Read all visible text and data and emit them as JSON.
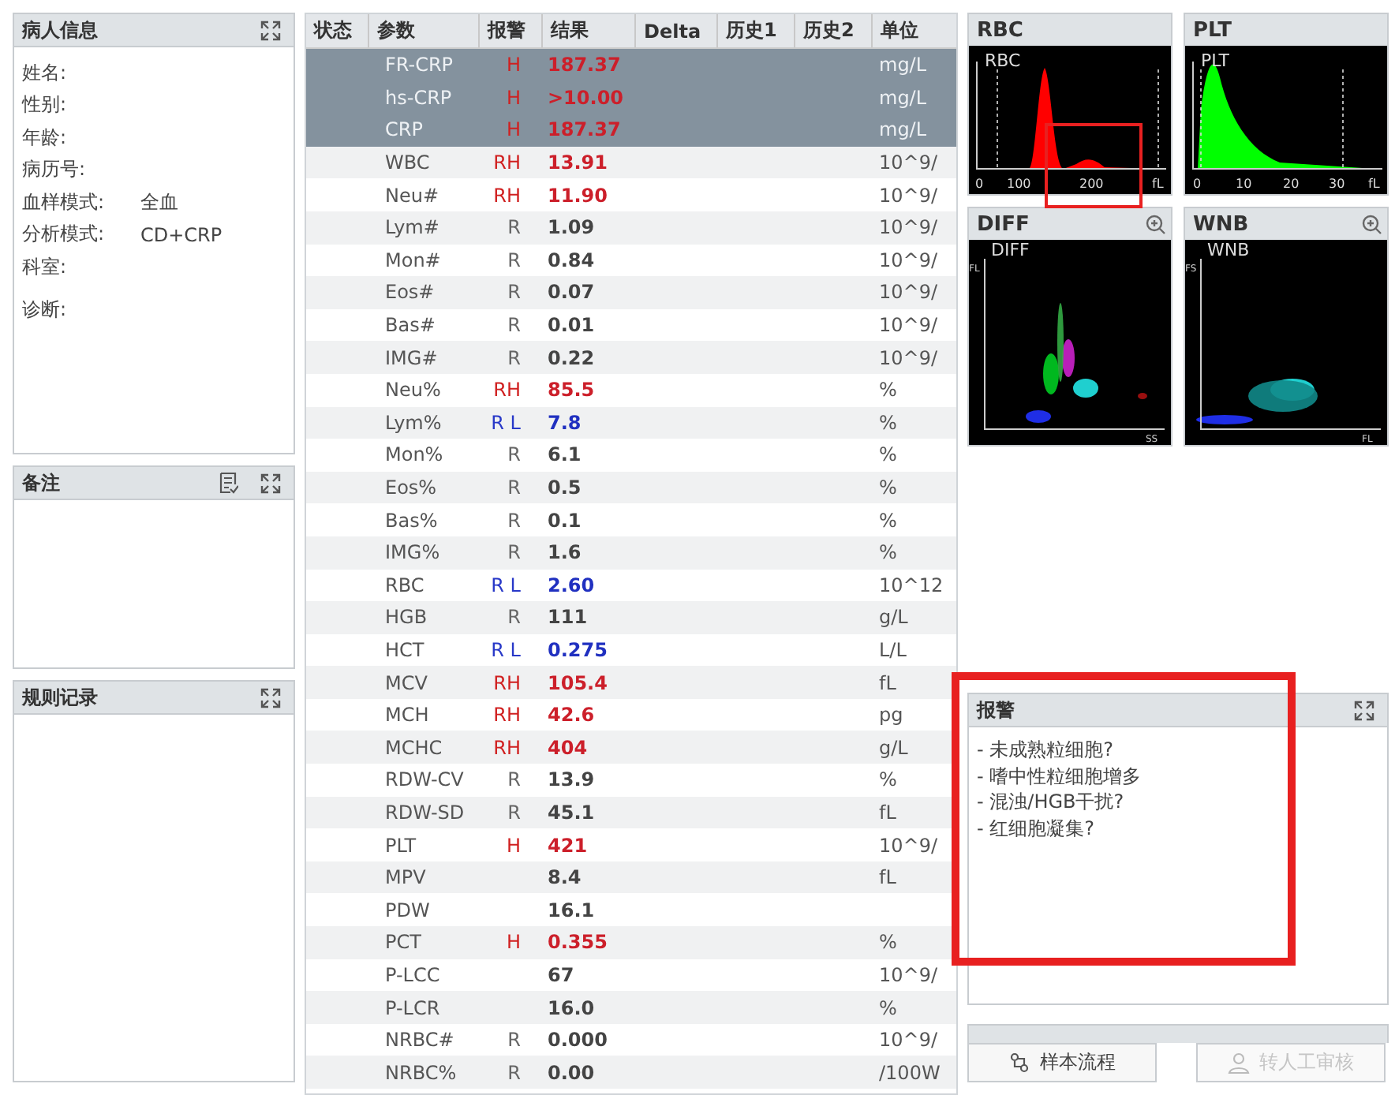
{
  "patient_panel": {
    "title": "病人信息",
    "fields": [
      {
        "label": "姓名:"
      },
      {
        "label": "性别:"
      },
      {
        "label": "年龄:"
      },
      {
        "label": "病历号:"
      },
      {
        "label": "血样模式:",
        "value": "全血"
      },
      {
        "label": "分析模式:",
        "value": "CD+CRP"
      },
      {
        "label": "科室:"
      },
      {
        "label": "诊断:"
      }
    ]
  },
  "notes_panel": {
    "title": "备注"
  },
  "rules_panel": {
    "title": "规则记录"
  },
  "table": {
    "columns": [
      "状态",
      "参数",
      "报警",
      "结果",
      "Delta",
      "历史1",
      "历史2",
      "单位"
    ],
    "rows": [
      {
        "param": "FR-CRP",
        "flag": "H",
        "result": "187.37",
        "unit": "mg/L",
        "kind": "high",
        "selected": true
      },
      {
        "param": "hs-CRP",
        "flag": "H",
        "result": ">10.00",
        "unit": "mg/L",
        "kind": "high",
        "selected": true
      },
      {
        "param": "CRP",
        "flag": "H",
        "result": "187.37",
        "unit": "mg/L",
        "kind": "high",
        "selected": true
      },
      {
        "param": "WBC",
        "flag": "RH",
        "result": "13.91",
        "unit": "10^9/",
        "kind": "high",
        "selected": false
      },
      {
        "param": "Neu#",
        "flag": "RH",
        "result": "11.90",
        "unit": "10^9/",
        "kind": "high",
        "selected": false
      },
      {
        "param": "Lym#",
        "flag": "R",
        "result": "1.09",
        "unit": "10^9/",
        "kind": "normal",
        "selected": false
      },
      {
        "param": "Mon#",
        "flag": "R",
        "result": "0.84",
        "unit": "10^9/",
        "kind": "normal",
        "selected": false
      },
      {
        "param": "Eos#",
        "flag": "R",
        "result": "0.07",
        "unit": "10^9/",
        "kind": "normal",
        "selected": false
      },
      {
        "param": "Bas#",
        "flag": "R",
        "result": "0.01",
        "unit": "10^9/",
        "kind": "normal",
        "selected": false
      },
      {
        "param": "IMG#",
        "flag": "R",
        "result": "0.22",
        "unit": "10^9/",
        "kind": "normal",
        "selected": false
      },
      {
        "param": "Neu%",
        "flag": "RH",
        "result": "85.5",
        "unit": "%",
        "kind": "high",
        "selected": false
      },
      {
        "param": "Lym%",
        "flag": "R L",
        "result": "7.8",
        "unit": "%",
        "kind": "low",
        "selected": false
      },
      {
        "param": "Mon%",
        "flag": "R",
        "result": "6.1",
        "unit": "%",
        "kind": "normal",
        "selected": false
      },
      {
        "param": "Eos%",
        "flag": "R",
        "result": "0.5",
        "unit": "%",
        "kind": "normal",
        "selected": false
      },
      {
        "param": "Bas%",
        "flag": "R",
        "result": "0.1",
        "unit": "%",
        "kind": "normal",
        "selected": false
      },
      {
        "param": "IMG%",
        "flag": "R",
        "result": "1.6",
        "unit": "%",
        "kind": "normal",
        "selected": false
      },
      {
        "param": "RBC",
        "flag": "R L",
        "result": "2.60",
        "unit": "10^12",
        "kind": "low",
        "selected": false
      },
      {
        "param": "HGB",
        "flag": "R",
        "result": "111",
        "unit": "g/L",
        "kind": "normal",
        "selected": false
      },
      {
        "param": "HCT",
        "flag": "R L",
        "result": "0.275",
        "unit": "L/L",
        "kind": "low",
        "selected": false
      },
      {
        "param": "MCV",
        "flag": "RH",
        "result": "105.4",
        "unit": "fL",
        "kind": "high",
        "selected": false
      },
      {
        "param": "MCH",
        "flag": "RH",
        "result": "42.6",
        "unit": "pg",
        "kind": "high",
        "selected": false
      },
      {
        "param": "MCHC",
        "flag": "RH",
        "result": "404",
        "unit": "g/L",
        "kind": "high",
        "selected": false
      },
      {
        "param": "RDW-CV",
        "flag": "R",
        "result": "13.9",
        "unit": "%",
        "kind": "normal",
        "selected": false
      },
      {
        "param": "RDW-SD",
        "flag": "R",
        "result": "45.1",
        "unit": "fL",
        "kind": "normal",
        "selected": false
      },
      {
        "param": "PLT",
        "flag": "H",
        "result": "421",
        "unit": "10^9/",
        "kind": "high",
        "selected": false
      },
      {
        "param": "MPV",
        "result": "8.4",
        "unit": "fL",
        "kind": "normal",
        "selected": false
      },
      {
        "param": "PDW",
        "result": "16.1",
        "kind": "normal",
        "selected": false
      },
      {
        "param": "PCT",
        "flag": "H",
        "result": "0.355",
        "unit": "%",
        "kind": "high",
        "selected": false
      },
      {
        "param": "P-LCC",
        "result": "67",
        "unit": "10^9/",
        "kind": "normal",
        "selected": false
      },
      {
        "param": "P-LCR",
        "result": "16.0",
        "unit": "%",
        "kind": "normal",
        "selected": false
      },
      {
        "param": "NRBC#",
        "flag": "R",
        "result": "0.000",
        "unit": "10^9/",
        "kind": "normal",
        "selected": false
      },
      {
        "param": "NRBC%",
        "flag": "R",
        "result": "0.00",
        "unit": "/100W",
        "kind": "normal",
        "selected": false
      }
    ]
  },
  "graphs": [
    {
      "title": "RBC",
      "kind": "histogram",
      "label": "RBC",
      "color": "#ff0000",
      "ticks": [
        "0",
        "100",
        "200",
        "fL"
      ]
    },
    {
      "title": "PLT",
      "kind": "histogram",
      "label": "PLT",
      "color": "#00ff00",
      "ticks": [
        "0",
        "10",
        "20",
        "30",
        "fL"
      ]
    },
    {
      "title": "DIFF",
      "kind": "scatter",
      "label": "DIFF",
      "zoomable": true,
      "y_axis": "FL",
      "x_axis": "SS"
    },
    {
      "title": "WNB",
      "kind": "scatter",
      "label": "WNB",
      "zoomable": true,
      "y_axis": "FS",
      "x_axis": "FL"
    }
  ],
  "alarm_panel": {
    "title": "报警",
    "messages": [
      "- 未成熟粒细胞?",
      "- 嗜中性粒细胞增多",
      "- 混浊/HGB干扰?",
      "- 红细胞凝集?"
    ]
  },
  "buttons": [
    {
      "label": "样本流程",
      "disabled": false
    },
    {
      "label": "转人工审核",
      "disabled": true
    }
  ]
}
